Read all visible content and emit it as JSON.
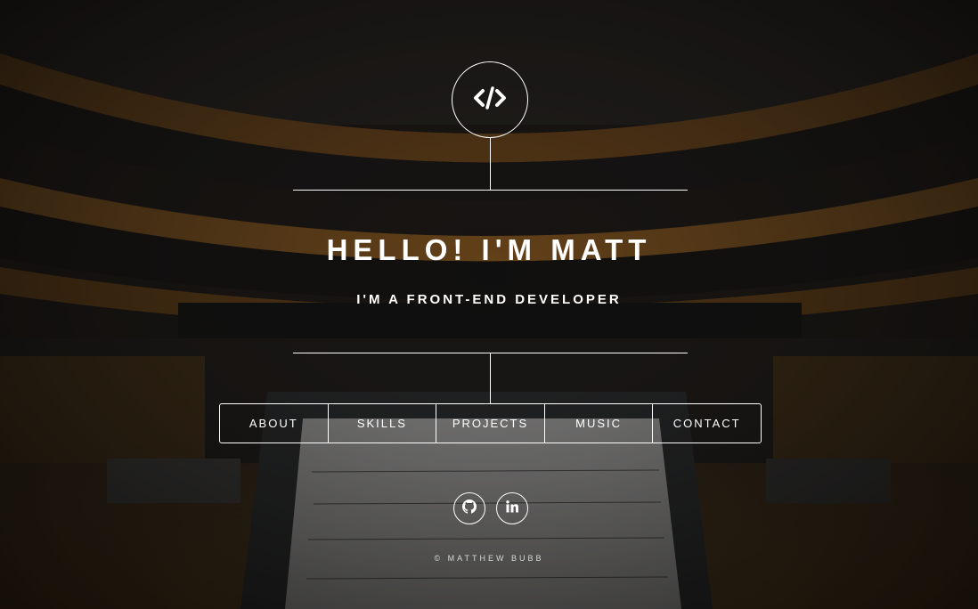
{
  "hero": {
    "logo_icon": "code-icon",
    "headline": "HELLO! I'M MATT",
    "subheadline": "I'M A FRONT-END DEVELOPER"
  },
  "nav": {
    "items": [
      {
        "label": "ABOUT"
      },
      {
        "label": "SKILLS"
      },
      {
        "label": "PROJECTS"
      },
      {
        "label": "MUSIC"
      },
      {
        "label": "CONTACT"
      }
    ]
  },
  "social": {
    "github_icon": "github-icon",
    "linkedin_icon": "linkedin-icon"
  },
  "footer": {
    "copyright": "© MATTHEW BUBB"
  },
  "colors": {
    "text": "#ffffff",
    "background_dark": "#1a1612",
    "wood_accent": "#8a5a22"
  }
}
